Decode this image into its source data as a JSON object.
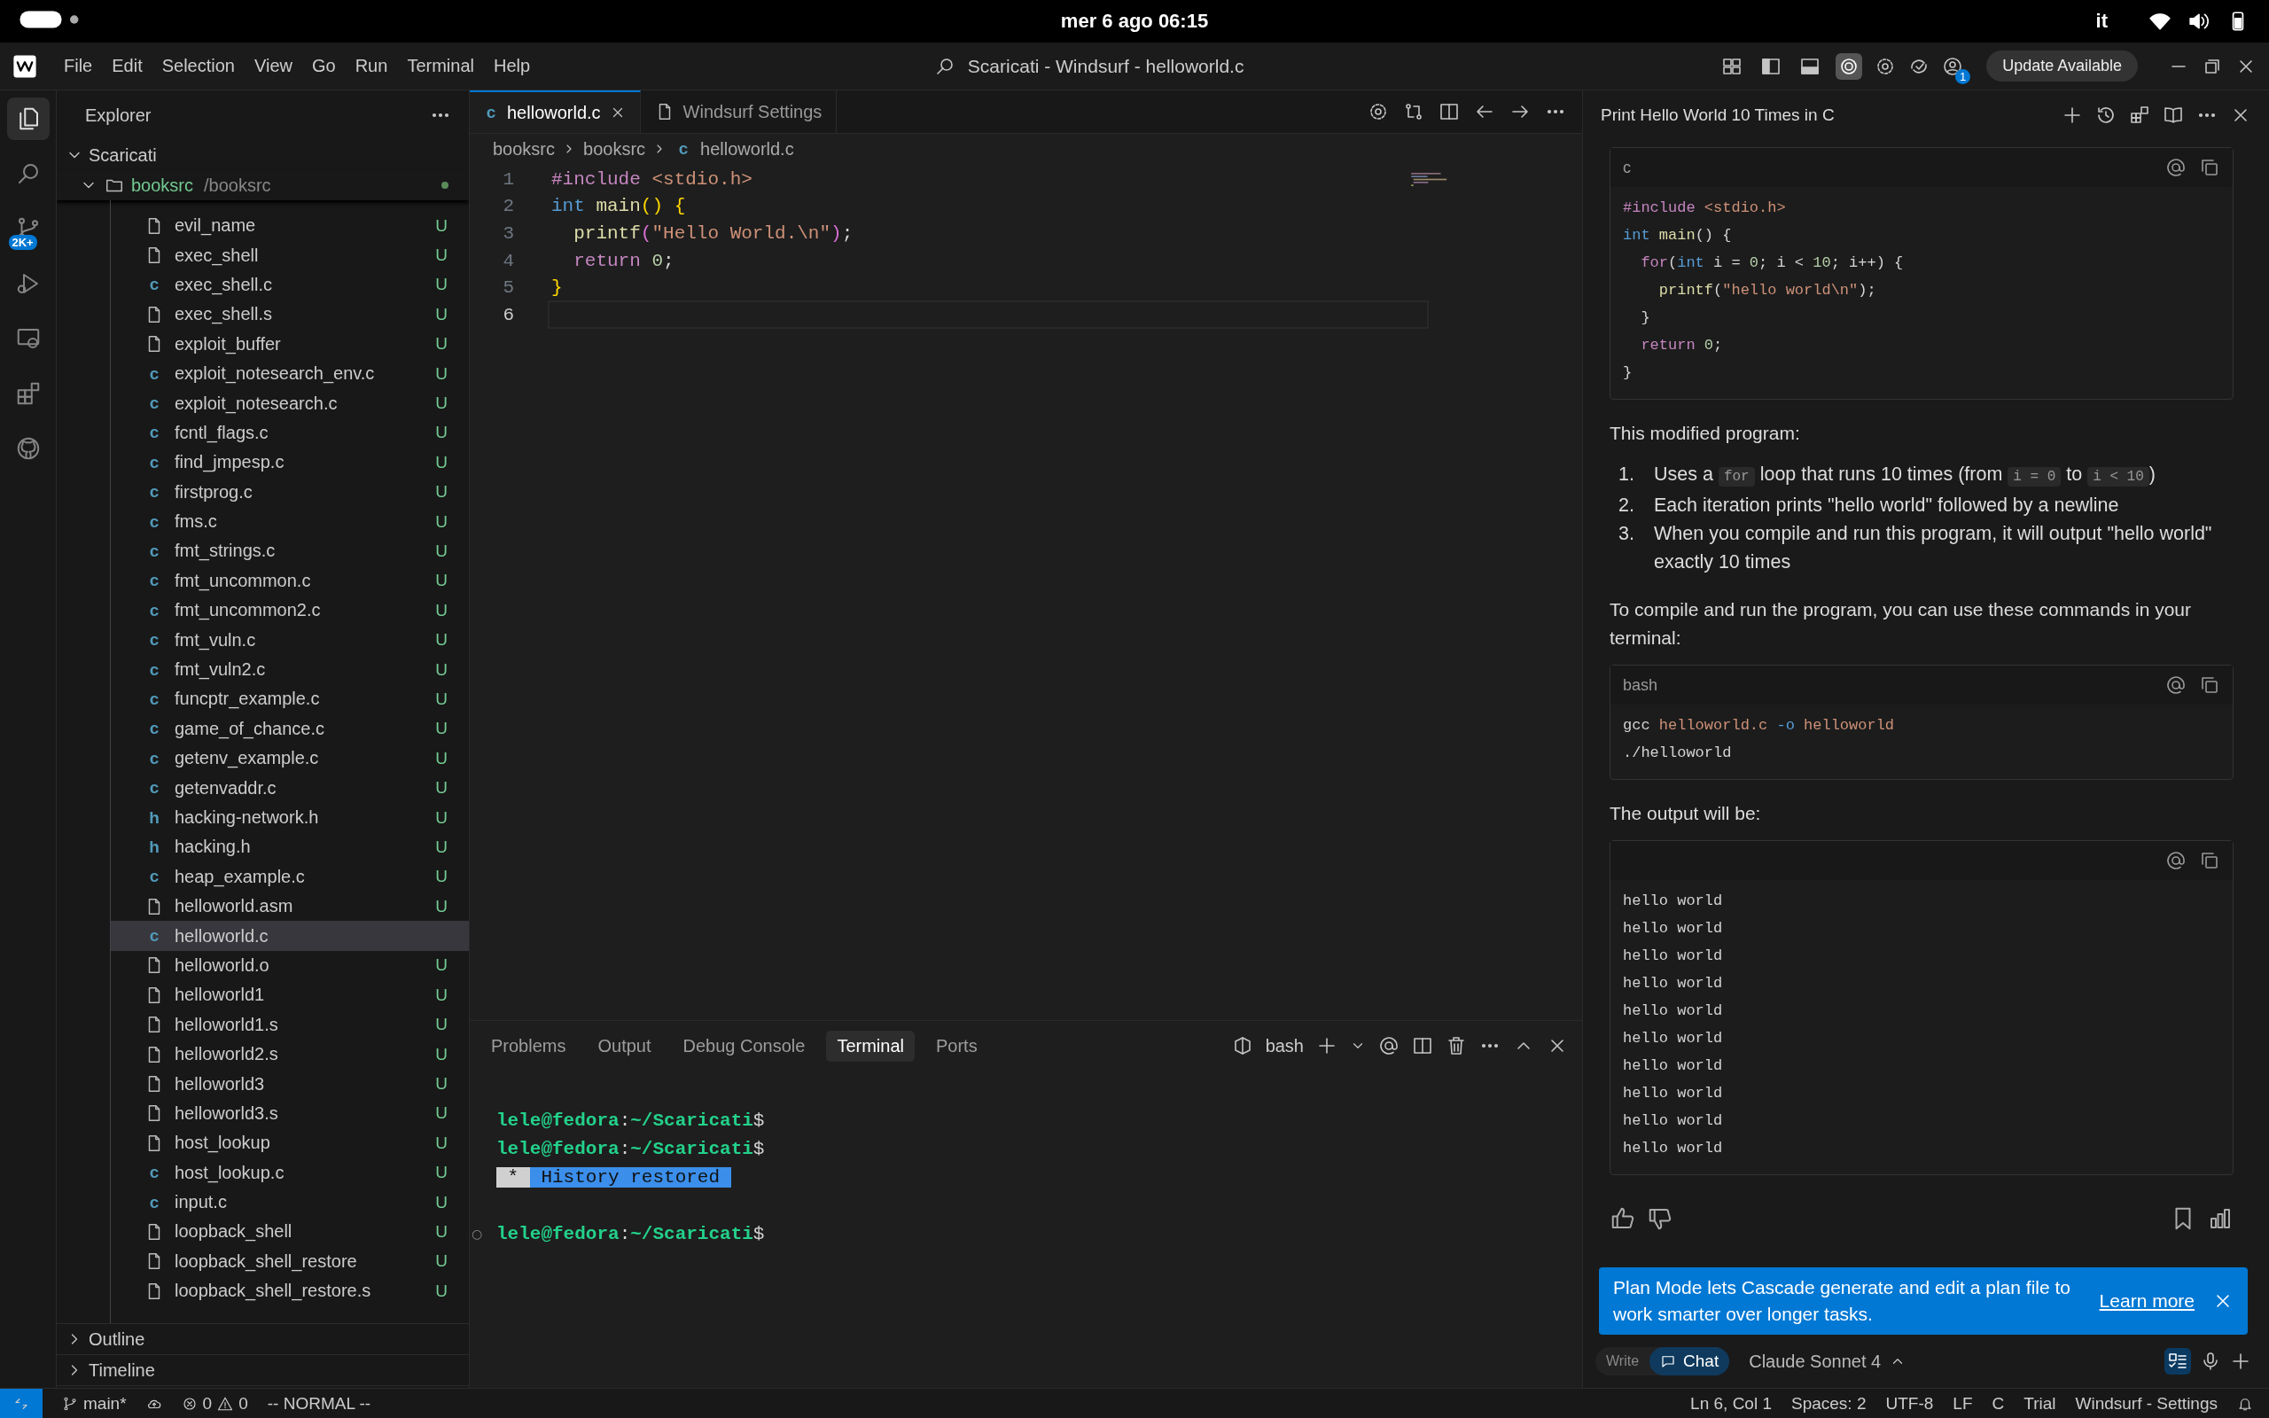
{
  "system_bar": {
    "date_time": "mer 6 ago  06:15",
    "keyboard": "it"
  },
  "title_bar": {
    "menu": [
      "File",
      "Edit",
      "Selection",
      "View",
      "Go",
      "Run",
      "Terminal",
      "Help"
    ],
    "title": "Scaricati - Windsurf - helloworld.c",
    "toggles": [
      {
        "kind": "layout",
        "on": false
      },
      {
        "kind": "sidebar",
        "on": false
      },
      {
        "kind": "panel",
        "on": false
      },
      {
        "kind": "cascade",
        "on": true
      }
    ],
    "account_badge": "1",
    "update_button": "Update Available"
  },
  "activity_bar": {
    "items": [
      {
        "kind": "files",
        "selected": true
      },
      {
        "kind": "search",
        "selected": false
      },
      {
        "kind": "branch",
        "selected": false,
        "badge": "2K+"
      },
      {
        "kind": "debug",
        "selected": false
      },
      {
        "kind": "remote",
        "selected": false
      },
      {
        "kind": "extensions",
        "selected": false
      },
      {
        "kind": "github",
        "selected": false
      }
    ]
  },
  "explorer": {
    "title": "Explorer",
    "root": {
      "label": "Scaricati",
      "expanded": true,
      "children": [
        {
          "label": "booksrc",
          "path": "/booksrc",
          "expanded": true,
          "children": [
            {
              "label": "evil_name",
              "status": "U",
              "selected": false
            },
            {
              "label": "exec_shell",
              "status": "U",
              "selected": false
            },
            {
              "label": "exec_shell.c",
              "icon": "c",
              "status": "U",
              "selected": false
            },
            {
              "label": "exec_shell.s",
              "status": "U",
              "selected": false
            },
            {
              "label": "exploit_buffer",
              "status": "U",
              "selected": false
            },
            {
              "label": "exploit_notesearch_env.c",
              "icon": "c",
              "status": "U",
              "selected": false
            },
            {
              "label": "exploit_notesearch.c",
              "icon": "c",
              "status": "U",
              "selected": false
            },
            {
              "label": "fcntl_flags.c",
              "icon": "c",
              "status": "U",
              "selected": false
            },
            {
              "label": "find_jmpesp.c",
              "icon": "c",
              "status": "U",
              "selected": false
            },
            {
              "label": "firstprog.c",
              "icon": "c",
              "status": "U",
              "selected": false
            },
            {
              "label": "fms.c",
              "icon": "c",
              "status": "U",
              "selected": false
            },
            {
              "label": "fmt_strings.c",
              "icon": "c",
              "status": "U",
              "selected": false
            },
            {
              "label": "fmt_uncommon.c",
              "icon": "c",
              "status": "U",
              "selected": false
            },
            {
              "label": "fmt_uncommon2.c",
              "icon": "c",
              "status": "U",
              "selected": false
            },
            {
              "label": "fmt_vuln.c",
              "icon": "c",
              "status": "U",
              "selected": false
            },
            {
              "label": "fmt_vuln2.c",
              "icon": "c",
              "status": "U",
              "selected": false
            },
            {
              "label": "funcptr_example.c",
              "icon": "c",
              "status": "U",
              "selected": false
            },
            {
              "label": "game_of_chance.c",
              "icon": "c",
              "status": "U",
              "selected": false
            },
            {
              "label": "getenv_example.c",
              "icon": "c",
              "status": "U",
              "selected": false
            },
            {
              "label": "getenvaddr.c",
              "icon": "c",
              "status": "U",
              "selected": false
            },
            {
              "label": "hacking-network.h",
              "icon": "h",
              "status": "U",
              "selected": false
            },
            {
              "label": "hacking.h",
              "icon": "h",
              "status": "U",
              "selected": false
            },
            {
              "label": "heap_example.c",
              "icon": "c",
              "status": "U",
              "selected": false
            },
            {
              "label": "helloworld.asm",
              "status": "U",
              "selected": false
            },
            {
              "label": "helloworld.c",
              "icon": "c",
              "selected": true
            },
            {
              "label": "helloworld.o",
              "status": "U",
              "selected": false
            },
            {
              "label": "helloworld1",
              "status": "U",
              "selected": false
            },
            {
              "label": "helloworld1.s",
              "status": "U",
              "selected": false
            },
            {
              "label": "helloworld2.s",
              "status": "U",
              "selected": false
            },
            {
              "label": "helloworld3",
              "status": "U",
              "selected": false
            },
            {
              "label": "helloworld3.s",
              "status": "U",
              "selected": false
            },
            {
              "label": "host_lookup",
              "status": "U",
              "selected": false
            },
            {
              "label": "host_lookup.c",
              "icon": "c",
              "status": "U",
              "selected": false
            },
            {
              "label": "input.c",
              "icon": "c",
              "status": "U",
              "selected": false
            },
            {
              "label": "loopback_shell",
              "status": "U",
              "selected": false
            },
            {
              "label": "loopback_shell_restore",
              "status": "U",
              "selected": false
            },
            {
              "label": "loopback_shell_restore.s",
              "status": "U",
              "selected": false
            }
          ]
        }
      ]
    },
    "sections": [
      {
        "label": "Outline",
        "expanded": false
      },
      {
        "label": "Timeline",
        "expanded": false
      }
    ]
  },
  "editor": {
    "tabs": [
      {
        "label": "helloworld.c",
        "icon": "c",
        "selected": true
      },
      {
        "label": "Windsurf Settings",
        "selected": false
      }
    ],
    "breadcrumb": [
      {
        "label": "booksrc"
      },
      {
        "label": "booksrc"
      },
      {
        "label": "helloworld.c",
        "icon": "c"
      }
    ],
    "lines": [
      {
        "number": "1",
        "current": false,
        "tokens": [
          {
            "text": "#include",
            "kind": "directive"
          },
          {
            "text": " <stdio.h>",
            "kind": "string"
          }
        ]
      },
      {
        "number": "2",
        "current": false,
        "tokens": [
          {
            "text": "int",
            "kind": "type"
          },
          {
            "text": " main",
            "kind": "function"
          },
          {
            "text": "()",
            "kind": "bracket"
          },
          {
            "text": " {",
            "kind": "bracket"
          }
        ]
      },
      {
        "number": "3",
        "current": false,
        "tokens": [
          {
            "text": "  printf",
            "kind": "function"
          },
          {
            "text": "(",
            "kind": "bracket2"
          },
          {
            "text": "\"Hello World.\\n\"",
            "kind": "string"
          },
          {
            "text": ")",
            "kind": "bracket2"
          },
          {
            "text": ";",
            "kind": "plain"
          }
        ]
      },
      {
        "number": "4",
        "current": false,
        "tokens": [
          {
            "text": "  return",
            "kind": "control"
          },
          {
            "text": " 0",
            "kind": "number"
          },
          {
            "text": ";",
            "kind": "plain"
          }
        ]
      },
      {
        "number": "5",
        "current": false,
        "tokens": [
          {
            "text": "}",
            "kind": "bracket"
          }
        ]
      },
      {
        "number": "6",
        "current": true
      }
    ]
  },
  "panel": {
    "tabs": [
      {
        "label": "Problems",
        "selected": false
      },
      {
        "label": "Output",
        "selected": false
      },
      {
        "label": "Debug Console",
        "selected": false
      },
      {
        "label": "Terminal",
        "selected": true
      },
      {
        "label": "Ports",
        "selected": false
      }
    ],
    "shell": "bash",
    "terminal": [
      {
        "parts": [
          {
            "text": "lele@fedora",
            "kind": "prompt"
          },
          {
            "text": ":",
            "kind": "plain"
          },
          {
            "text": "~/Scaricati",
            "kind": "prompt"
          },
          {
            "text": "$",
            "kind": "plain"
          }
        ]
      },
      {
        "parts": [
          {
            "text": "lele@fedora",
            "kind": "prompt"
          },
          {
            "text": ":",
            "kind": "plain"
          },
          {
            "text": "~/Scaricati",
            "kind": "prompt"
          },
          {
            "text": "$",
            "kind": "plain"
          }
        ]
      },
      {
        "parts": [
          {
            "text": " * ",
            "kind": "chip"
          },
          {
            "text": " History restored ",
            "kind": "banner"
          }
        ]
      },
      {
        "marker": "○",
        "parts": [
          {
            "text": "lele@fedora",
            "kind": "prompt"
          },
          {
            "text": ":",
            "kind": "plain"
          },
          {
            "text": "~/Scaricati",
            "kind": "prompt"
          },
          {
            "text": "$",
            "kind": "plain"
          }
        ]
      }
    ]
  },
  "chat": {
    "title": "Print Hello World 10 Times in C",
    "blocks": [
      {
        "kind": "code",
        "language": "c",
        "lines": [
          [
            {
              "text": "#include",
              "kind": "directive"
            },
            {
              "text": " <stdio.h>",
              "kind": "string"
            }
          ],
          [
            {
              "text": "int",
              "kind": "type"
            },
            {
              "text": " main",
              "kind": "function"
            },
            {
              "text": "() {",
              "kind": "plain"
            }
          ],
          [
            {
              "text": "  for",
              "kind": "control"
            },
            {
              "text": "(",
              "kind": "plain"
            },
            {
              "text": "int",
              "kind": "type"
            },
            {
              "text": " i = ",
              "kind": "plain"
            },
            {
              "text": "0",
              "kind": "number"
            },
            {
              "text": "; i < ",
              "kind": "plain"
            },
            {
              "text": "10",
              "kind": "number"
            },
            {
              "text": "; i++) {",
              "kind": "plain"
            }
          ],
          [
            {
              "text": "    printf",
              "kind": "function"
            },
            {
              "text": "(",
              "kind": "plain"
            },
            {
              "text": "\"hello world\\n\"",
              "kind": "string"
            },
            {
              "text": ");",
              "kind": "plain"
            }
          ],
          [
            {
              "text": "  }",
              "kind": "plain"
            }
          ],
          [
            {
              "text": "  return",
              "kind": "control"
            },
            {
              "text": " 0",
              "kind": "number"
            },
            {
              "text": ";",
              "kind": "plain"
            }
          ],
          [
            {
              "text": "}",
              "kind": "plain"
            }
          ]
        ]
      },
      {
        "kind": "paragraph",
        "text": "This modified program:"
      },
      {
        "kind": "list",
        "items": [
          {
            "number": "1.",
            "parts": [
              {
                "kind": "text",
                "text": "Uses a "
              },
              {
                "kind": "code",
                "text": "for"
              },
              {
                "kind": "text",
                "text": " loop that runs 10 times (from "
              },
              {
                "kind": "code",
                "text": "i = 0"
              },
              {
                "kind": "text",
                "text": " to "
              },
              {
                "kind": "code",
                "text": "i < 10"
              },
              {
                "kind": "text",
                "text": ")"
              }
            ]
          },
          {
            "number": "2.",
            "parts": [
              {
                "kind": "text",
                "text": "Each iteration prints \"hello world\" followed by a newline"
              }
            ]
          },
          {
            "number": "3.",
            "parts": [
              {
                "kind": "text",
                "text": "When you compile and run this program, it will output \"hello world\" exactly 10 times"
              }
            ]
          }
        ]
      },
      {
        "kind": "paragraph",
        "text": "To compile and run the program, you can use these commands in your terminal:"
      },
      {
        "kind": "code",
        "language": "bash",
        "lines": [
          [
            {
              "text": "gcc",
              "kind": "plain"
            },
            {
              "text": " helloworld.c",
              "kind": "string"
            },
            {
              "text": " -o",
              "kind": "type"
            },
            {
              "text": " helloworld",
              "kind": "string"
            }
          ],
          [
            {
              "text": "./helloworld",
              "kind": "plain"
            }
          ]
        ]
      },
      {
        "kind": "paragraph",
        "text": "The output will be:"
      },
      {
        "kind": "code",
        "lines": [
          [
            {
              "text": "hello world",
              "kind": "plain"
            }
          ],
          [
            {
              "text": "hello world",
              "kind": "plain"
            }
          ],
          [
            {
              "text": "hello world",
              "kind": "plain"
            }
          ],
          [
            {
              "text": "hello world",
              "kind": "plain"
            }
          ],
          [
            {
              "text": "hello world",
              "kind": "plain"
            }
          ],
          [
            {
              "text": "hello world",
              "kind": "plain"
            }
          ],
          [
            {
              "text": "hello world",
              "kind": "plain"
            }
          ],
          [
            {
              "text": "hello world",
              "kind": "plain"
            }
          ],
          [
            {
              "text": "hello world",
              "kind": "plain"
            }
          ],
          [
            {
              "text": "hello world",
              "kind": "plain"
            }
          ]
        ]
      }
    ],
    "toast": {
      "text": "Plan Mode lets Cascade generate and edit a plan file to work smarter over longer tasks.",
      "link": "Learn more"
    },
    "modes": [
      {
        "label": "Write",
        "selected": false
      },
      {
        "label": "Chat",
        "selected": true
      }
    ],
    "model": "Claude Sonnet 4",
    "plan_mode_on": true
  },
  "status_bar": {
    "branch": "main*",
    "errors": "0",
    "warnings": "0",
    "mode": "-- NORMAL --",
    "right": [
      "Ln 6, Col 1",
      "Spaces: 2",
      "UTF-8",
      "LF",
      "C",
      "Trial",
      "Windsurf - Settings"
    ]
  }
}
